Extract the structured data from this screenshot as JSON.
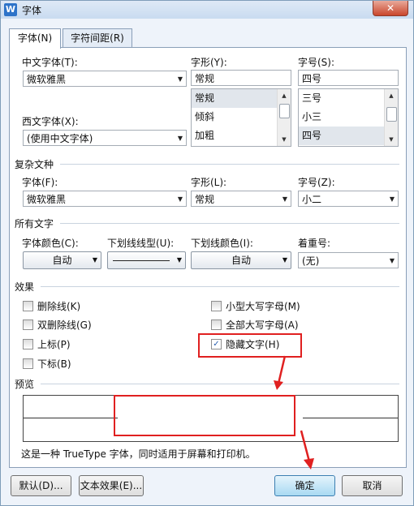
{
  "window": {
    "title": "字体",
    "close_glyph": "✕",
    "app_icon": "W"
  },
  "tabs": [
    {
      "label": "字体(N)"
    },
    {
      "label": "字符间距(R)"
    }
  ],
  "font": {
    "cn_font_label": "中文字体(T):",
    "cn_font_value": "微软雅黑",
    "style_label": "字形(Y):",
    "style_value": "常规",
    "style_options": [
      "常规",
      "倾斜",
      "加粗"
    ],
    "size_label": "字号(S):",
    "size_value": "四号",
    "size_options": [
      "三号",
      "小三",
      "四号"
    ],
    "west_font_label": "西文字体(X):",
    "west_font_value": "(使用中文字体)"
  },
  "complex": {
    "group_label": "复杂文种",
    "font_label": "字体(F):",
    "font_value": "微软雅黑",
    "style_label": "字形(L):",
    "style_value": "常规",
    "size_label": "字号(Z):",
    "size_value": "小二"
  },
  "all_text": {
    "group_label": "所有文字",
    "color_label": "字体颜色(C):",
    "color_value": "自动",
    "underline_label": "下划线线型(U):",
    "underline_color_label": "下划线颜色(I):",
    "underline_color_value": "自动",
    "emphasis_label": "着重号:",
    "emphasis_value": "(无)"
  },
  "effects": {
    "group_label": "效果",
    "items": [
      {
        "label": "删除线(K)",
        "checked": false
      },
      {
        "label": "双删除线(G)",
        "checked": false
      },
      {
        "label": "上标(P)",
        "checked": false
      },
      {
        "label": "下标(B)",
        "checked": false
      },
      {
        "label": "小型大写字母(M)",
        "checked": false
      },
      {
        "label": "全部大写字母(A)",
        "checked": false
      },
      {
        "label": "隐藏文字(H)",
        "checked": true
      }
    ]
  },
  "preview": {
    "group_label": "预览",
    "note": "这是一种 TrueType 字体，同时适用于屏幕和打印机。"
  },
  "buttons": {
    "default": "默认(D)...",
    "text_effects": "文本效果(E)...",
    "ok": "确定",
    "cancel": "取消"
  },
  "colors": {
    "highlight": "#e02020",
    "accent": "#2d73c9"
  }
}
